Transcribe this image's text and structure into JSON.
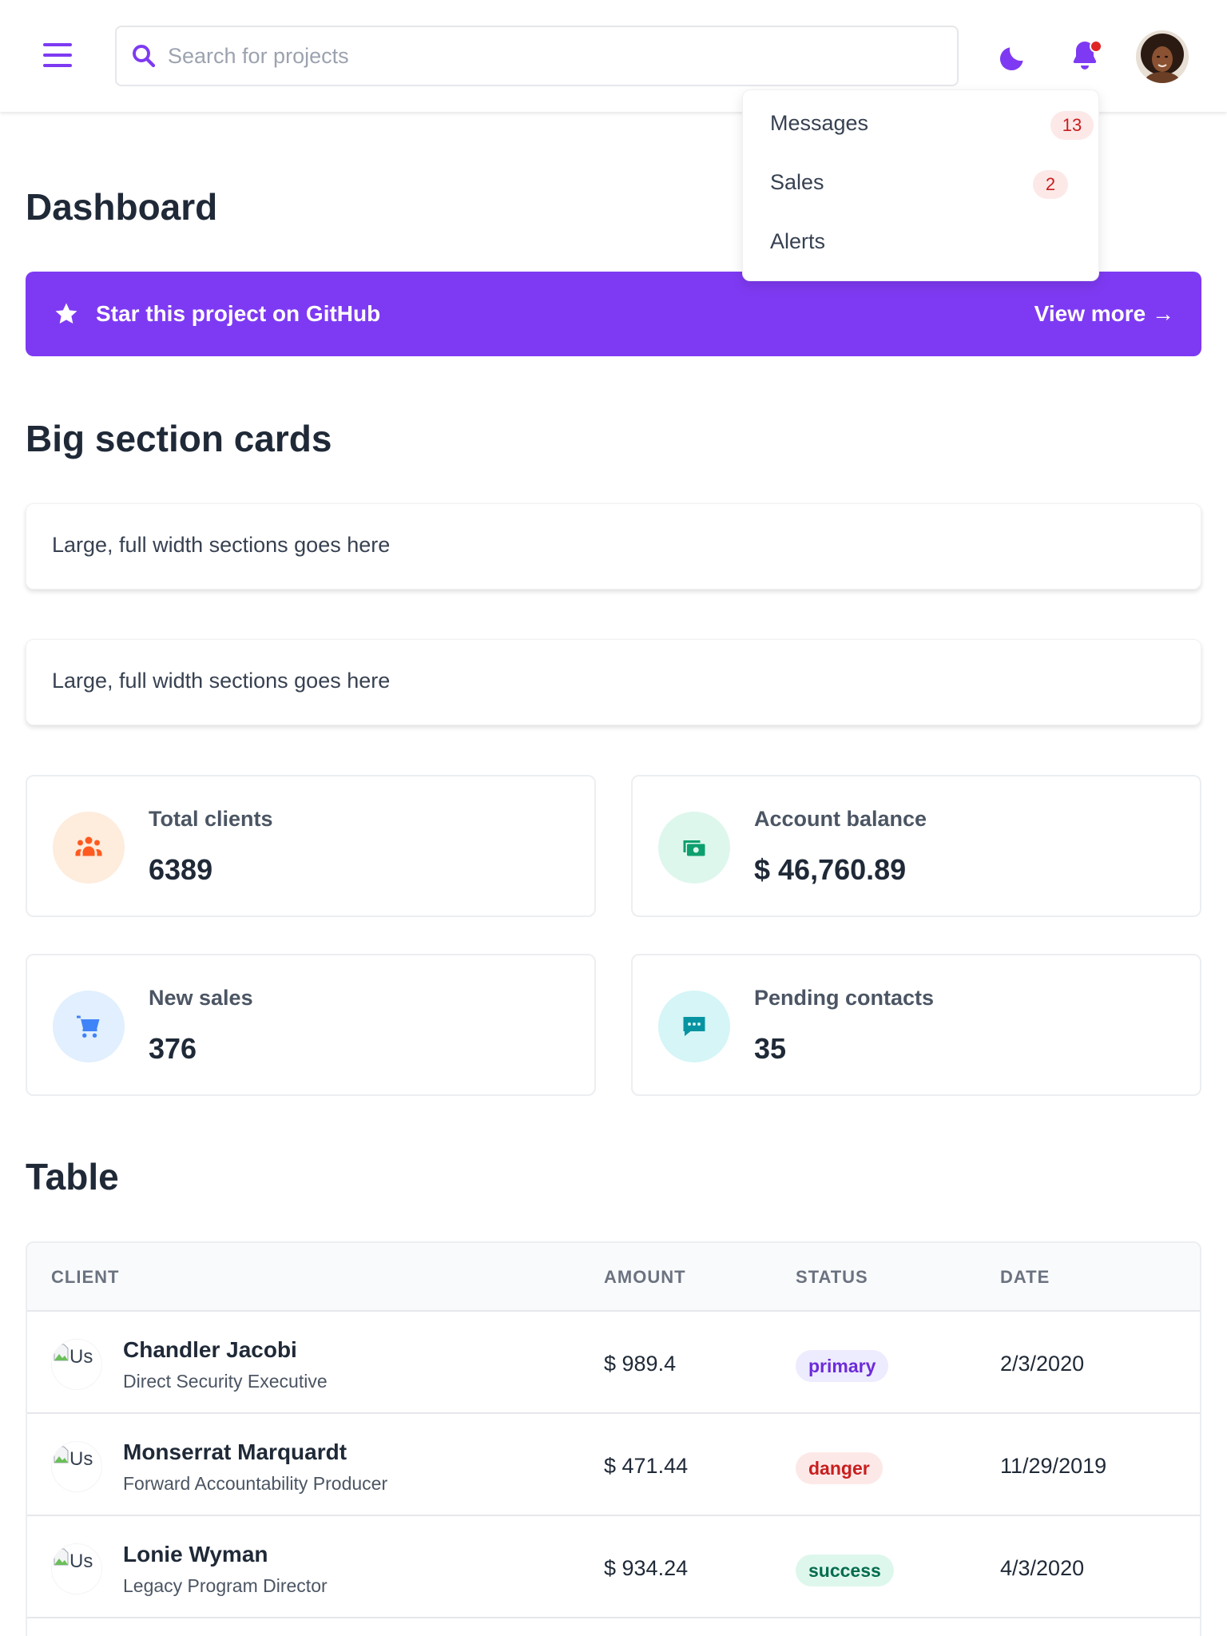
{
  "header": {
    "search_placeholder": "Search for projects"
  },
  "notifications_menu": {
    "items": [
      {
        "label": "Messages",
        "badge": "13"
      },
      {
        "label": "Sales",
        "badge": "2"
      },
      {
        "label": "Alerts",
        "badge": null
      }
    ]
  },
  "page": {
    "title": "Dashboard"
  },
  "banner": {
    "text": "Star this project on GitHub",
    "link": "View more →"
  },
  "big_section": {
    "title": "Big section cards",
    "cards": [
      "Large, full width sections goes here",
      "Large, full width sections goes here"
    ]
  },
  "stats": [
    {
      "label": "Total clients",
      "value": "6389",
      "icon": "users-icon",
      "color": "#ff5a1f",
      "bg": "#feecdc"
    },
    {
      "label": "Account balance",
      "value": "$ 46,760.89",
      "icon": "cash-icon",
      "color": "#0e9f6e",
      "bg": "#def7ec"
    },
    {
      "label": "New sales",
      "value": "376",
      "icon": "cart-icon",
      "color": "#3f83f8",
      "bg": "#e1effe"
    },
    {
      "label": "Pending contacts",
      "value": "35",
      "icon": "chat-icon",
      "color": "#0694a2",
      "bg": "#d5f5f6"
    }
  ],
  "table": {
    "title": "Table",
    "columns": [
      "CLIENT",
      "AMOUNT",
      "STATUS",
      "DATE"
    ],
    "image_alt": "Us",
    "rows": [
      {
        "name": "Chandler Jacobi",
        "role": "Direct Security Executive",
        "amount": "$ 989.4",
        "status": "primary",
        "date": "2/3/2020"
      },
      {
        "name": "Monserrat Marquardt",
        "role": "Forward Accountability Producer",
        "amount": "$ 471.44",
        "status": "danger",
        "date": "11/29/2019"
      },
      {
        "name": "Lonie Wyman",
        "role": "Legacy Program Director",
        "amount": "$ 934.24",
        "status": "success",
        "date": "4/3/2020"
      }
    ]
  },
  "colors": {
    "accent": "#7e3af2",
    "danger": "#e02424"
  }
}
